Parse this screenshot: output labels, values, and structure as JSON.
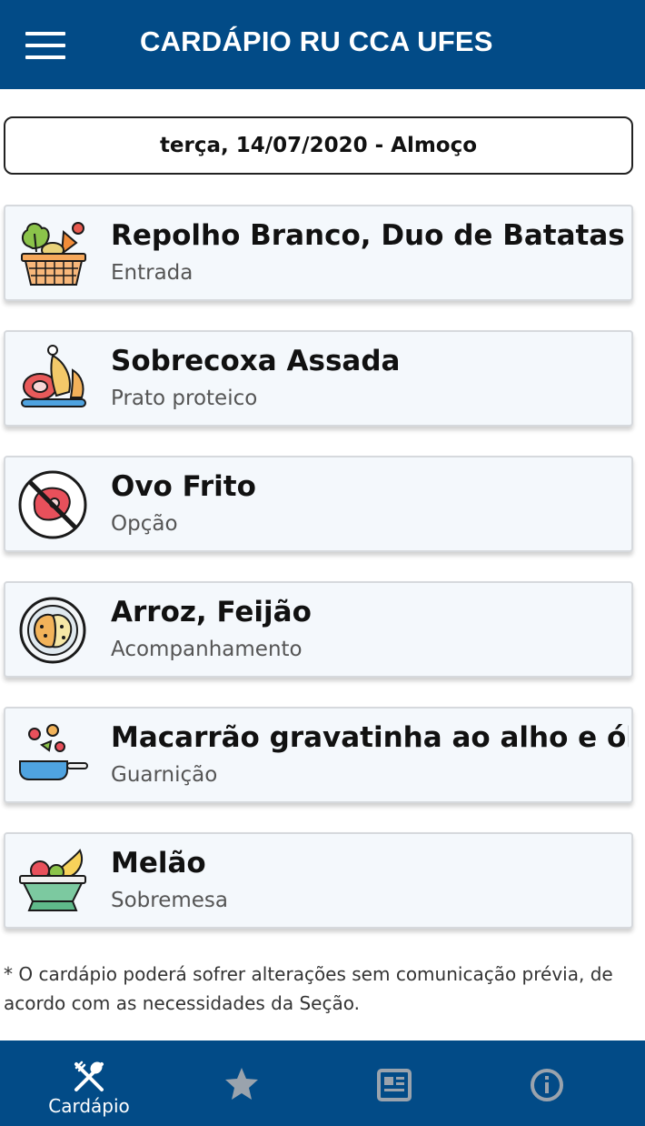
{
  "app_bar": {
    "menu_icon": "hamburger-menu-icon",
    "title": "CARDÁPIO RU CCA UFES",
    "color": "#024b87"
  },
  "date_selector": {
    "label": "terça, 14/07/2020 - Almoço"
  },
  "menu_items": [
    {
      "name": "Repolho Branco, Duo de Batatas",
      "category": "Entrada",
      "icon": "vegetable-basket-icon"
    },
    {
      "name": "Sobrecoxa Assada",
      "category": "Prato proteico",
      "icon": "roast-meat-platter-icon"
    },
    {
      "name": "Ovo Frito",
      "category": "Opção",
      "icon": "no-meat-icon"
    },
    {
      "name": "Arroz, Feijão",
      "category": "Acompanhamento",
      "icon": "rice-plate-icon"
    },
    {
      "name": "Macarrão gravatinha ao alho e óle",
      "category": "Guarnição",
      "icon": "frying-pan-icon"
    },
    {
      "name": "Melão",
      "category": "Sobremesa",
      "icon": "fruit-bowl-icon"
    }
  ],
  "disclaimer": "* O cardápio poderá sofrer alterações sem comunicação prévia, de acordo com as necessidades da Seção.",
  "bottom_nav": {
    "items": [
      {
        "label": "Cardápio",
        "icon": "fork-knife-icon",
        "active": true
      },
      {
        "label": "",
        "icon": "star-icon",
        "active": false
      },
      {
        "label": "",
        "icon": "news-icon",
        "active": false
      },
      {
        "label": "",
        "icon": "info-icon",
        "active": false
      }
    ],
    "active_color": "#ffffff",
    "inactive_color": "#9aa3ad"
  }
}
